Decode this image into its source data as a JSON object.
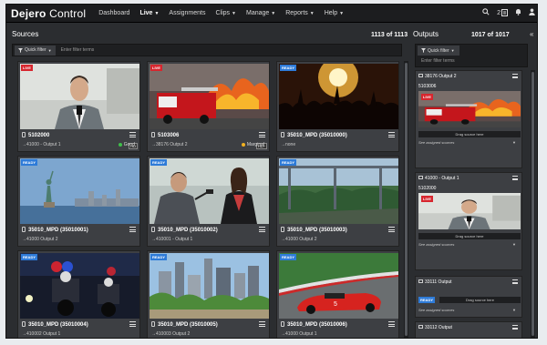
{
  "app": {
    "brand_bold": "Dejero",
    "brand_light": " Control"
  },
  "nav": [
    {
      "label": "Dashboard",
      "caret": ""
    },
    {
      "label": "Live",
      "caret": "▼"
    },
    {
      "label": "Assignments",
      "caret": ""
    },
    {
      "label": "Clips",
      "caret": "▼"
    },
    {
      "label": "Manage",
      "caret": "▼"
    },
    {
      "label": "Reports",
      "caret": "▼"
    },
    {
      "label": "Help",
      "caret": "▼"
    }
  ],
  "topbar_icons": {
    "search": "search-icon",
    "meter": "meter-icon",
    "bell": "bell-icon",
    "user": "user-icon",
    "badge_count": "2"
  },
  "sources": {
    "title": "Sources",
    "count": "1113 of 1113",
    "quick_filter": "Quick filter",
    "filter_placeholder": "Enter filter terms",
    "cards": [
      {
        "badge": "LIVE",
        "name": "5102000",
        "output": "→41000 - Output 1",
        "status": "Good",
        "status_color": "#3fbf4a",
        "hd": "HD",
        "scene": "man"
      },
      {
        "badge": "LIVE",
        "name": "5103006",
        "output": "→38176 Output 2",
        "status": "Marginal",
        "status_color": "#f0b021",
        "hd": "HD+",
        "scene": "fire"
      },
      {
        "badge": "READY",
        "name": "35010_MPD (35010000)",
        "output": "→none",
        "status": "",
        "status_color": "",
        "hd": "",
        "scene": "crowd"
      },
      {
        "badge": "READY",
        "name": "35010_MPD (35010001)",
        "output": "→41000 Output 2",
        "status": "",
        "status_color": "",
        "hd": "",
        "scene": "liberty"
      },
      {
        "badge": "READY",
        "name": "35010_MPD (35010002)",
        "output": "→410001 - Output 1",
        "status": "",
        "status_color": "",
        "hd": "",
        "scene": "interview"
      },
      {
        "badge": "READY",
        "name": "35010_MPD (35010003)",
        "output": "→41000 Output 2",
        "status": "",
        "status_color": "",
        "hd": "",
        "scene": "bridge"
      },
      {
        "badge": "READY",
        "name": "35010_MPD (35010004)",
        "output": "→410002 Output 1",
        "status": "",
        "status_color": "",
        "hd": "",
        "scene": "moto"
      },
      {
        "badge": "READY",
        "name": "35010_MPD (35010005)",
        "output": "→410003 Output 2",
        "status": "",
        "status_color": "",
        "hd": "",
        "scene": "city"
      },
      {
        "badge": "READY",
        "name": "35010_MPD (35010006)",
        "output": "→41000 Output 1",
        "status": "",
        "status_color": "",
        "hd": "",
        "scene": "race"
      }
    ]
  },
  "outputs": {
    "title": "Outputs",
    "count": "1017 of 1017",
    "quick_filter": "Quick filter",
    "filter_placeholder": "Enter filter terms",
    "cards": [
      {
        "header": "38176 Output 2",
        "source": "5103006",
        "badge": "LIVE",
        "drag": "Drag source here",
        "see": "See assigned sources",
        "scene": "fire"
      },
      {
        "header": "41000 - Output 1",
        "source": "5102000",
        "badge": "LIVE",
        "drag": "Drag source here",
        "see": "See assigned sources",
        "scene": "man"
      },
      {
        "header": "33111 Output",
        "source": "",
        "badge": "READY",
        "drag": "Drag source here",
        "see": "See assigned sources",
        "scene": ""
      },
      {
        "header": "33112 Output",
        "source": "",
        "badge": "",
        "drag": "",
        "see": "",
        "scene": ""
      }
    ]
  },
  "colors": {
    "live": "#d7262e",
    "ready": "#2e7bd8",
    "bg": "#2b2d30"
  }
}
